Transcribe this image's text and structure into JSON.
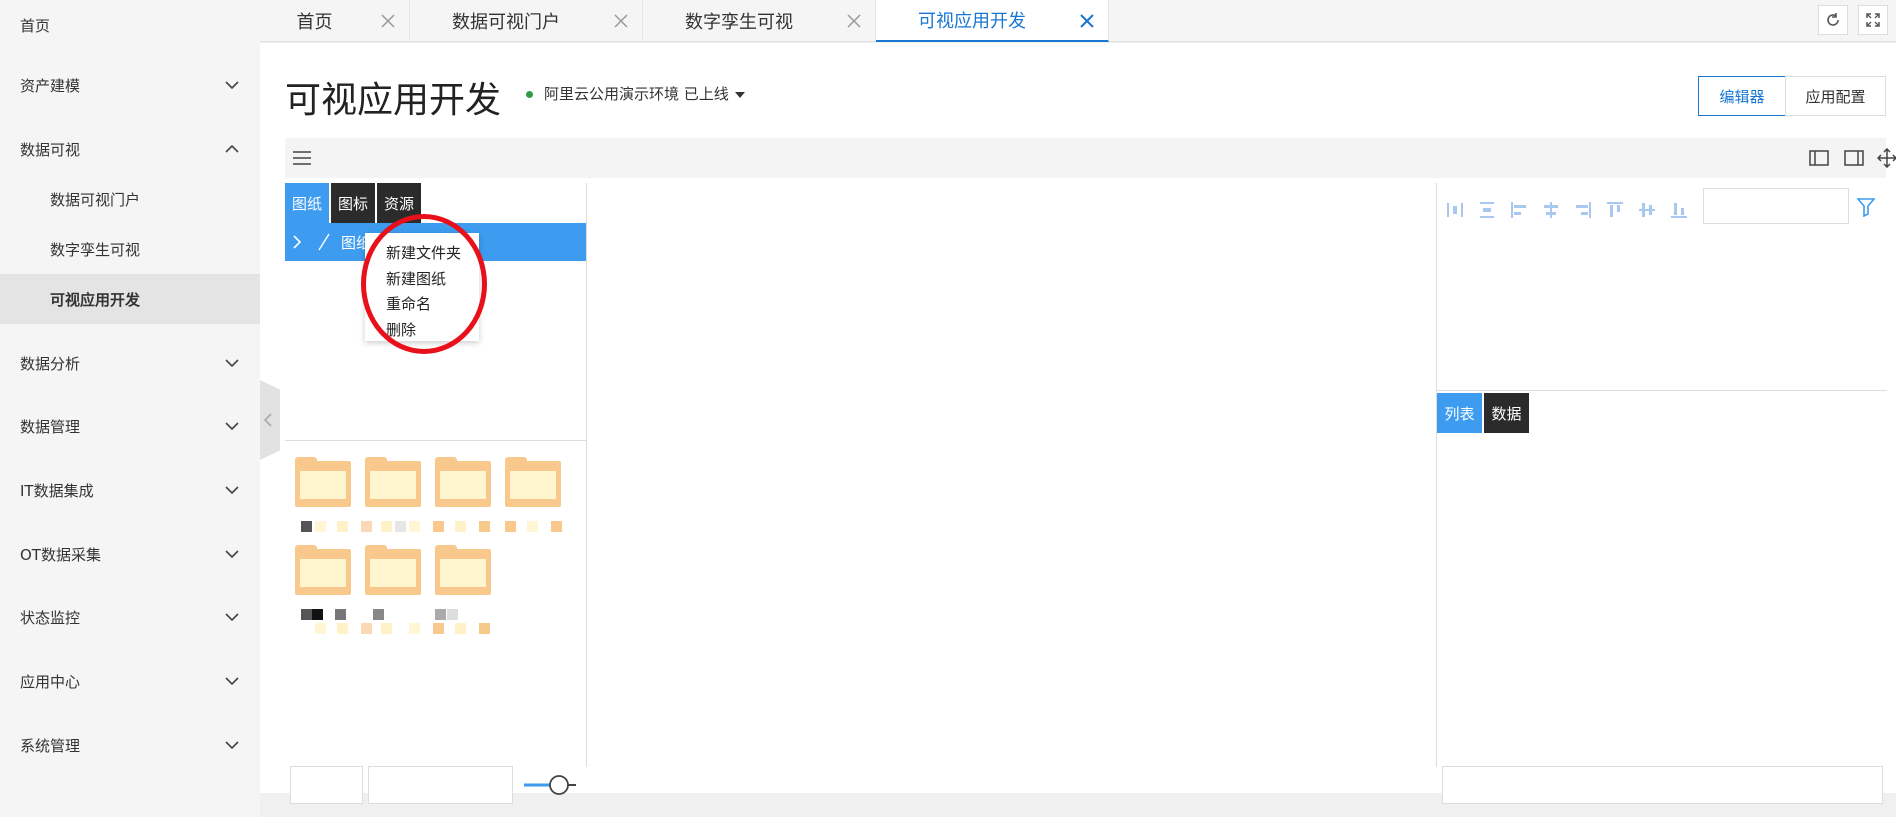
{
  "sidebar": {
    "items": [
      {
        "label": "首页",
        "has_chevron": false
      },
      {
        "label": "资产建模",
        "has_chevron": true,
        "expanded": false
      },
      {
        "label": "数据可视",
        "has_chevron": true,
        "expanded": true
      },
      {
        "label": "数据可视门户",
        "sub": true
      },
      {
        "label": "数字孪生可视",
        "sub": true
      },
      {
        "label": "可视应用开发",
        "sub": true,
        "active": true
      },
      {
        "label": "数据分析",
        "has_chevron": true,
        "expanded": false
      },
      {
        "label": "数据管理",
        "has_chevron": true,
        "expanded": false
      },
      {
        "label": "IT数据集成",
        "has_chevron": true,
        "expanded": false
      },
      {
        "label": "OT数据采集",
        "has_chevron": true,
        "expanded": false
      },
      {
        "label": "状态监控",
        "has_chevron": true,
        "expanded": false
      },
      {
        "label": "应用中心",
        "has_chevron": true,
        "expanded": false
      },
      {
        "label": "系统管理",
        "has_chevron": true,
        "expanded": false
      }
    ]
  },
  "tabs": [
    {
      "label": "首页",
      "active": false
    },
    {
      "label": "数据可视门户",
      "active": false
    },
    {
      "label": "数字孪生可视",
      "active": false
    },
    {
      "label": "可视应用开发",
      "active": true
    }
  ],
  "header": {
    "title": "可视应用开发",
    "environment": "阿里云公用演示环境 已上线",
    "editor_button": "编辑器",
    "config_button": "应用配置"
  },
  "left_panel": {
    "tabs": [
      "图纸",
      "图标",
      "资源"
    ],
    "active_tab": "图纸",
    "tree_root": "图纸"
  },
  "context_menu": {
    "items": [
      "新建文件夹",
      "新建图纸",
      "重命名",
      "删除"
    ]
  },
  "right_panel": {
    "tabs": [
      "列表",
      "数据"
    ],
    "active_tab": "列表"
  },
  "colors": {
    "accent": "#1976d2",
    "panel_tab_active": "#3d9cf0",
    "panel_tab": "#2b2b2b",
    "folder": "#f9c88d",
    "highlight_circle": "#e8101a",
    "status_online": "#2e9c4a"
  }
}
